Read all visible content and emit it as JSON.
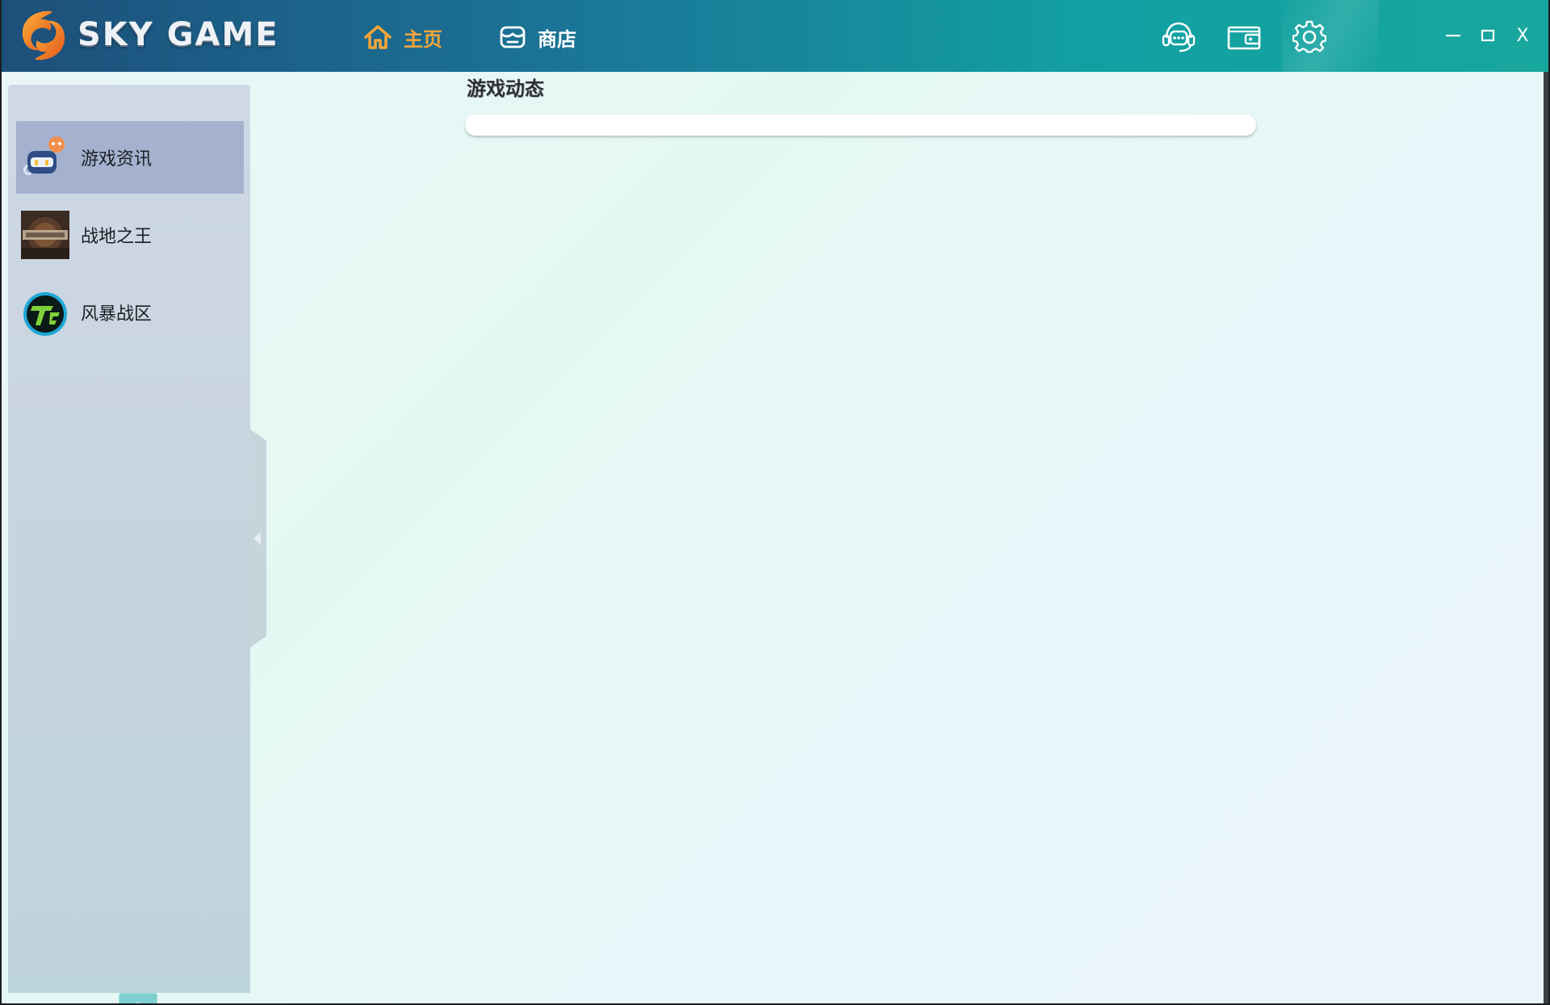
{
  "app": {
    "logo_text": "SKY GAME",
    "logo_icon": "sky-game-logo-icon"
  },
  "nav": {
    "home_label": "主页",
    "shop_label": "商店",
    "active": "home",
    "active_color": "#f6a63a"
  },
  "header_icons": [
    "customer-service-icon",
    "wallet-icon",
    "gear-icon"
  ],
  "window_controls": {
    "minimize": "—",
    "maximize": "☐",
    "close": "X"
  },
  "sidebar": {
    "items": [
      {
        "label": "游戏资讯",
        "icon": "game-news-icon",
        "active": true
      },
      {
        "label": "战地之王",
        "icon": "game-avatar-zhandi-icon",
        "active": false
      },
      {
        "label": "风暴战区",
        "icon": "game-avatar-fengbao-icon",
        "active": false
      }
    ],
    "add_icon": "plus-icon"
  },
  "main": {
    "section_title": "游戏动态"
  },
  "colors": {
    "header_start": "#1d4f7a",
    "header_end": "#18a79e",
    "sidebar_active": "#a4b2cf",
    "add_button": "#7fcfd0"
  }
}
